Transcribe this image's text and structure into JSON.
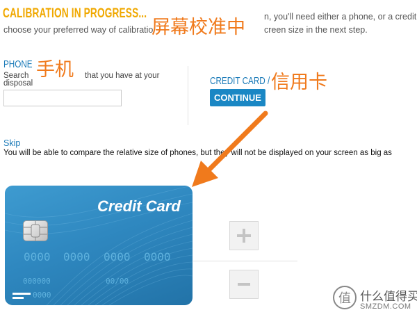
{
  "header": {
    "title": "CALIBRATION IN PROGRESS...",
    "intro_line1_end": "n, you'll need either a phone, or a credit c",
    "intro_line2_start": "choose your preferred way of calibratio",
    "intro_line2_end": "creen size in the next step."
  },
  "annotations": {
    "calibration": "屏幕校准中",
    "phone": "手机",
    "credit_card": "信用卡"
  },
  "phone_section": {
    "heading": "PHONE",
    "search_label": "Search",
    "instruction_a": "that you have at your",
    "instruction_b": "disposal",
    "input_value": "",
    "input_placeholder": ""
  },
  "credit_card_section": {
    "heading": "CREDIT CARD /",
    "continue_label": "CONTINUE"
  },
  "skip": {
    "link_label": "Skip",
    "note": "You will be able to compare the relative size of phones, but they will not be displayed on your screen as big as"
  },
  "card": {
    "title": "Credit Card",
    "number_groups": [
      "0000",
      "0000",
      "0000",
      "0000"
    ],
    "small_number": "000000",
    "expiry": "00/00",
    "tail": "0000"
  },
  "zoom": {
    "plus_icon": "plus-icon",
    "minus_icon": "minus-icon"
  },
  "watermark": {
    "text": "什么值得买",
    "sub": "SMZDM.COM"
  },
  "colors": {
    "title_orange": "#f0a800",
    "annotation_orange": "#f07a1c",
    "link_blue": "#1a7ab8",
    "button_blue": "#1a87c4",
    "card_blue": "#2f88c0"
  }
}
